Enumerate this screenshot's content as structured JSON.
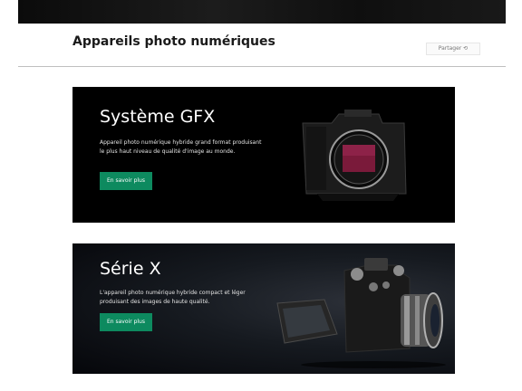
{
  "header": {
    "title": "Appareils photo numériques",
    "share_label": "Partager ⟲"
  },
  "cards": [
    {
      "title": "Système GFX",
      "description": "Appareil photo numérique hybride grand format produisant le plus haut niveau de qualité d'image au monde.",
      "button_label": "En savoir plus",
      "image_icon": "medium-format-camera-body-icon"
    },
    {
      "title": "Série X",
      "description": "L'appareil photo numérique hybride compact et léger produisant des images de haute qualité.",
      "button_label": "En savoir plus",
      "image_icon": "x-series-camera-with-lens-icon"
    }
  ],
  "colors": {
    "button_green": "#0d8a5f",
    "card_background": "#000000",
    "sensor_red": "#7a1a3a"
  }
}
